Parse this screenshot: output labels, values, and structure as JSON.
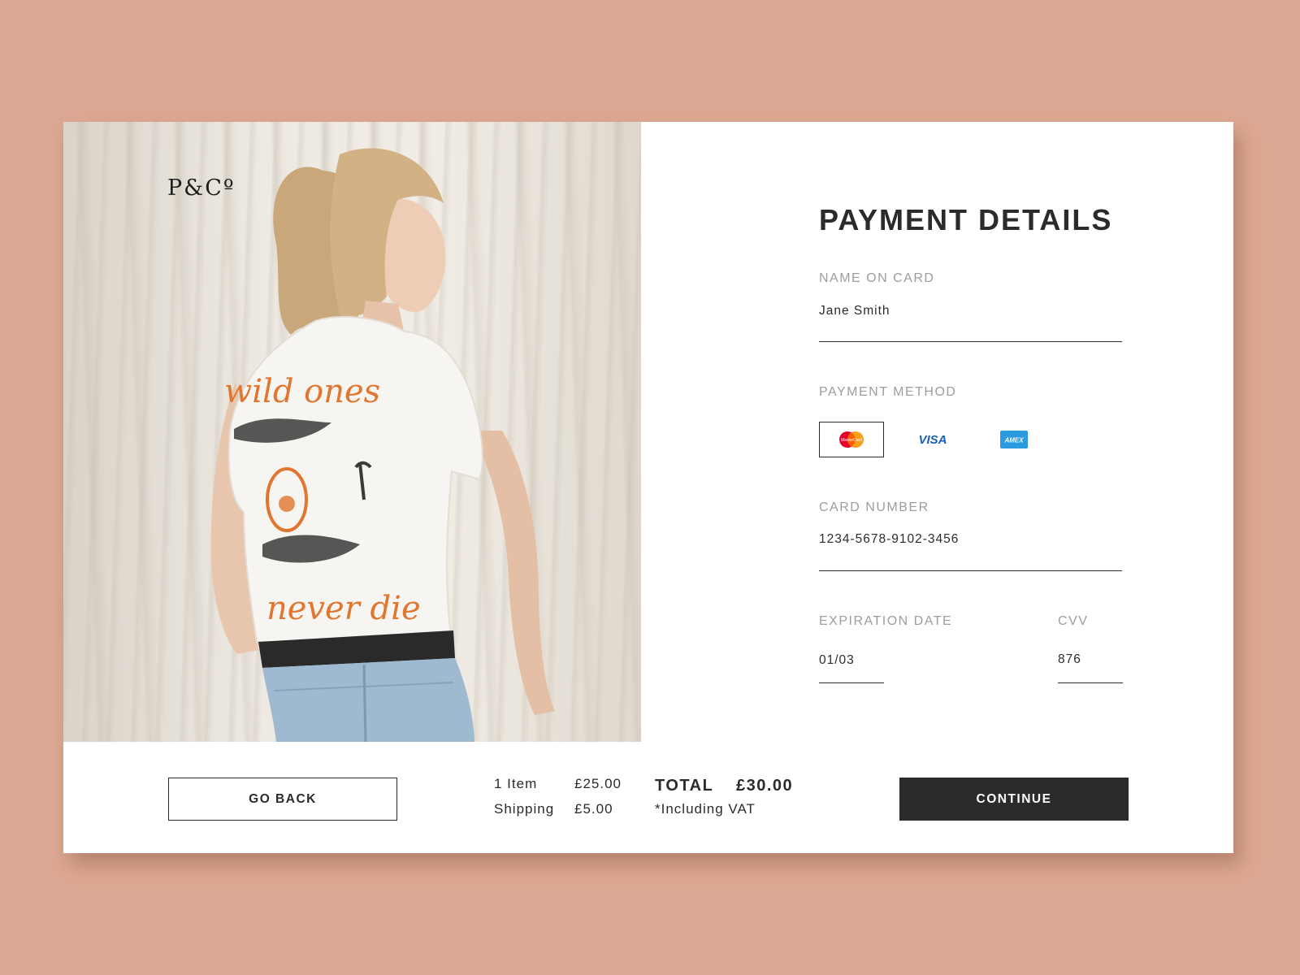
{
  "brand": {
    "logo_text": "P&Cº"
  },
  "product_image": {
    "shirt_text_top": "wild ones",
    "shirt_text_bottom": "never die"
  },
  "form": {
    "title": "PAYMENT DETAILS",
    "name_on_card": {
      "label": "NAME ON CARD",
      "value": "Jane Smith"
    },
    "payment_method": {
      "label": "PAYMENT METHOD",
      "options": [
        {
          "name": "MasterCard",
          "icon": "mastercard-icon",
          "selected": true
        },
        {
          "name": "VISA",
          "icon": "visa-icon",
          "selected": false
        },
        {
          "name": "AMEX",
          "icon": "amex-icon",
          "selected": false
        }
      ]
    },
    "card_number": {
      "label": "CARD NUMBER",
      "value": "1234-5678-9102-3456"
    },
    "expiration_date": {
      "label": "EXPIRATION DATE",
      "value": "01/03"
    },
    "cvv": {
      "label": "CVV",
      "value": "876"
    }
  },
  "footer": {
    "back_label": "GO BACK",
    "continue_label": "CONTINUE",
    "summary": {
      "items_label": "1 Item",
      "items_price": "£25.00",
      "shipping_label": "Shipping",
      "shipping_price": "£5.00"
    },
    "total": {
      "label": "TOTAL",
      "amount": "£30.00",
      "note": "*Including VAT"
    }
  },
  "colors": {
    "background": "#DDA893",
    "dark": "#2B2B2B",
    "label_gray": "#A09C99",
    "shirt_print": "#E0762F",
    "visa_blue": "#1A5FB4",
    "amex_blue": "#2A9BE0"
  }
}
